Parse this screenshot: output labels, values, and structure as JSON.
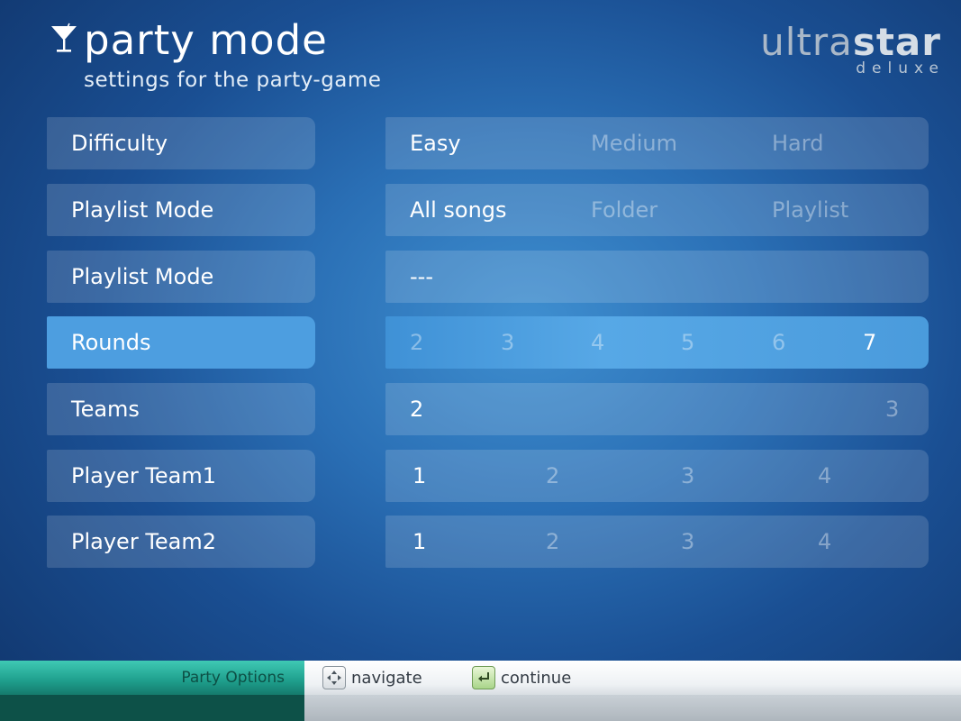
{
  "header": {
    "title": "party mode",
    "subtitle": "settings for the party-game",
    "icon": "cocktail-glass-icon"
  },
  "logo": {
    "main_a": "ultra",
    "main_b": "star",
    "sub": "deluxe"
  },
  "settings": [
    {
      "label": "Difficulty",
      "options": [
        {
          "text": "Easy",
          "selected": true
        },
        {
          "text": "Medium",
          "selected": false
        },
        {
          "text": "Hard",
          "selected": false
        }
      ]
    },
    {
      "label": "Playlist Mode",
      "options": [
        {
          "text": "All songs",
          "selected": true
        },
        {
          "text": "Folder",
          "selected": false
        },
        {
          "text": "Playlist",
          "selected": false
        }
      ]
    },
    {
      "label": "Playlist Mode",
      "options": [
        {
          "text": "---",
          "selected": true
        }
      ]
    },
    {
      "label": "Rounds",
      "active": true,
      "options": [
        {
          "text": "2",
          "selected": false
        },
        {
          "text": "3",
          "selected": false
        },
        {
          "text": "4",
          "selected": false
        },
        {
          "text": "5",
          "selected": false
        },
        {
          "text": "6",
          "selected": false
        },
        {
          "text": "7",
          "selected": true
        }
      ]
    },
    {
      "label": "Teams",
      "options": [
        {
          "text": "2",
          "selected": true
        },
        {
          "text": "3",
          "selected": false
        }
      ]
    },
    {
      "label": "Player Team1",
      "options": [
        {
          "text": "1",
          "selected": true
        },
        {
          "text": "2",
          "selected": false
        },
        {
          "text": "3",
          "selected": false
        },
        {
          "text": "4",
          "selected": false
        }
      ]
    },
    {
      "label": "Player Team2",
      "options": [
        {
          "text": "1",
          "selected": true
        },
        {
          "text": "2",
          "selected": false
        },
        {
          "text": "3",
          "selected": false
        },
        {
          "text": "4",
          "selected": false
        }
      ]
    }
  ],
  "bottom_bar": {
    "section": "Party Options",
    "hints": [
      {
        "icon": "dpad-icon",
        "label": "navigate"
      },
      {
        "icon": "enter-key-icon",
        "label": "continue"
      }
    ]
  }
}
